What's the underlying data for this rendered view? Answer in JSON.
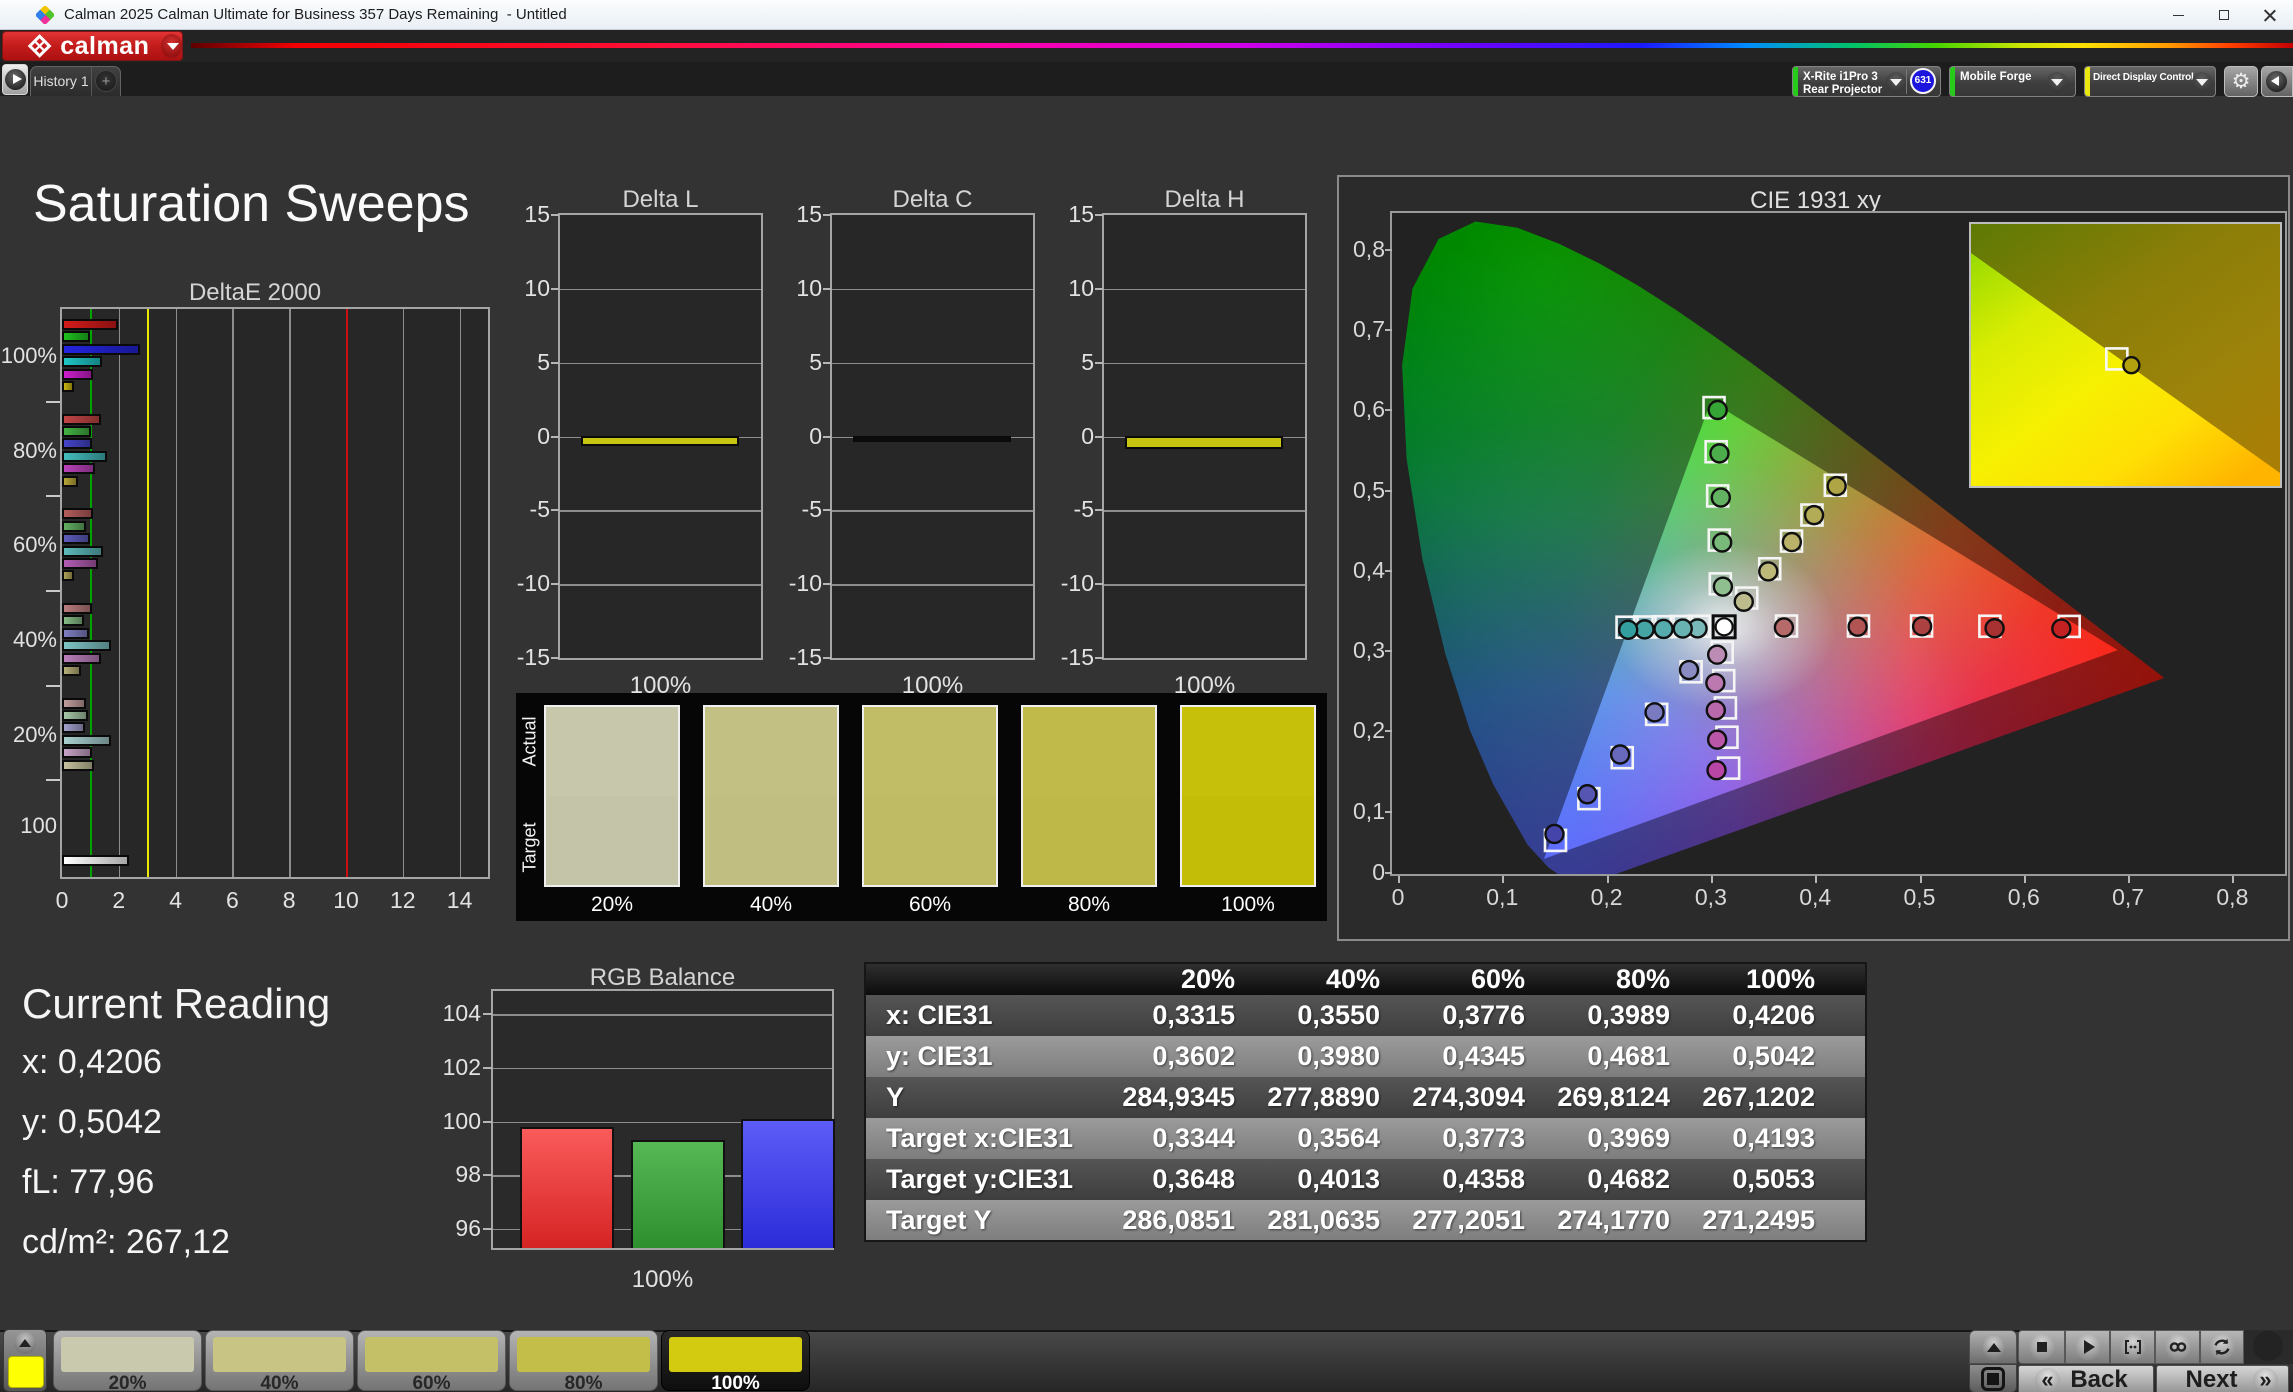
{
  "window": {
    "title": "Calman 2025 Calman Ultimate for Business 357 Days Remaining  - Untitled",
    "icon": "calman-app-icon",
    "controls": {
      "minimize": "minimize",
      "maximize": "maximize",
      "close": "close"
    }
  },
  "logo_bar": {
    "brand": "calman",
    "caret": "dropdown"
  },
  "tab_bar": {
    "play": "play",
    "tab": "History 1",
    "add_tab": "+",
    "meter_button": {
      "line1": "X-Rite i1Pro 3",
      "line2": "Rear Projector",
      "badge": "631",
      "stripe_color": "#27cc1a"
    },
    "source_button": {
      "label": "Mobile Forge",
      "stripe_color": "#27cc1a"
    },
    "ddc_button": {
      "label": "Direct Display Control",
      "stripe_color": "#e8e80e"
    },
    "gear": "settings",
    "back_arrow": "previous"
  },
  "page": {
    "title": "Saturation Sweeps"
  },
  "current_reading": {
    "title": "Current Reading",
    "lines": [
      "x: 0,4206",
      "y: 0,5042",
      "fL: 77,96",
      "cd/m²: 267,12"
    ]
  },
  "swatch_panel": {
    "row_labels": [
      "Actual",
      "Target"
    ],
    "items": [
      {
        "label": "20%",
        "actual": "#c7c7ab",
        "target": "#c4c4a8"
      },
      {
        "label": "40%",
        "actual": "#c3c083",
        "target": "#c1be81"
      },
      {
        "label": "60%",
        "actual": "#c0bd66",
        "target": "#bebb64"
      },
      {
        "label": "80%",
        "actual": "#bfba49",
        "target": "#bdb847"
      },
      {
        "label": "100%",
        "actual": "#c6c00a",
        "target": "#c3bd08"
      }
    ]
  },
  "bottom_bar": {
    "swatch_color": "#ffff04",
    "thumbs": [
      {
        "label": "20%",
        "color": "#c9c9ae",
        "selected": false
      },
      {
        "label": "40%",
        "color": "#c7c484",
        "selected": false
      },
      {
        "label": "60%",
        "color": "#c4c067",
        "selected": false
      },
      {
        "label": "80%",
        "color": "#c3be4a",
        "selected": false
      },
      {
        "label": "100%",
        "color": "#d2cb10",
        "selected": true
      }
    ],
    "back_label": "Back",
    "next_label": "Next",
    "transport": [
      "stop",
      "play",
      "loop-range",
      "infinite",
      "refresh"
    ]
  },
  "chart_data": [
    {
      "id": "deltae2000",
      "type": "bar",
      "orientation": "horizontal",
      "title": "DeltaE 2000",
      "xlim": [
        0,
        15
      ],
      "xticks": [
        0,
        2,
        4,
        6,
        8,
        10,
        12,
        14
      ],
      "ref_lines": [
        {
          "value": 1,
          "color": "#00a400"
        },
        {
          "value": 3,
          "color": "#e8e800"
        },
        {
          "value": 10,
          "color": "#cc1010"
        }
      ],
      "groups": [
        {
          "label": "100%",
          "values": [
            1.98,
            0.98,
            2.76,
            1.4,
            1.1,
            0.44
          ],
          "colors": [
            "#d31b1b",
            "#1fc01f",
            "#2424e0",
            "#1fc6c6",
            "#cc1fcc",
            "#c9b512"
          ]
        },
        {
          "label": "80%",
          "values": [
            1.38,
            1.02,
            1.06,
            1.6,
            1.15,
            0.56
          ],
          "colors": [
            "#c34545",
            "#43b243",
            "#4545cb",
            "#43bcbc",
            "#bc43bc",
            "#b7a738"
          ]
        },
        {
          "label": "60%",
          "values": [
            1.08,
            0.86,
            1.0,
            1.44,
            1.26,
            0.42
          ],
          "colors": [
            "#b55d5d",
            "#62ae62",
            "#5d5dbd",
            "#5dbaba",
            "#b25db2",
            "#aea157"
          ]
        },
        {
          "label": "40%",
          "values": [
            1.06,
            0.76,
            0.94,
            1.74,
            1.36,
            0.68
          ],
          "colors": [
            "#ba7c7c",
            "#85ba85",
            "#7f7fc2",
            "#7fc4c4",
            "#bc7fbc",
            "#b7af78"
          ]
        },
        {
          "label": "20%",
          "values": [
            0.86,
            0.9,
            0.8,
            1.72,
            1.04,
            1.13
          ],
          "colors": [
            "#c29e9e",
            "#a6c6a6",
            "#a0a0cc",
            "#a8cfcf",
            "#c6a3c6",
            "#c6c29e"
          ]
        },
        {
          "label": "100",
          "values": [
            2.35
          ],
          "colors": [
            "#ffffff"
          ]
        }
      ]
    },
    {
      "id": "delta_l",
      "type": "bar",
      "title": "Delta L",
      "ylim": [
        -15,
        15
      ],
      "yticks": [
        15,
        10,
        5,
        0,
        -5,
        -10,
        -15
      ],
      "categories": [
        "100%"
      ],
      "values": [
        -0.35
      ],
      "color": "#c8c412"
    },
    {
      "id": "delta_c",
      "type": "bar",
      "title": "Delta C",
      "ylim": [
        -15,
        15
      ],
      "yticks": [
        15,
        10,
        5,
        0,
        -5,
        -10,
        -15
      ],
      "categories": [
        "100%"
      ],
      "values": [
        -0.12
      ],
      "color": "#0c0c0c"
    },
    {
      "id": "delta_h",
      "type": "bar",
      "title": "Delta H",
      "ylim": [
        -15,
        15
      ],
      "yticks": [
        15,
        10,
        5,
        0,
        -5,
        -10,
        -15
      ],
      "categories": [
        "100%"
      ],
      "values": [
        -0.55
      ],
      "color": "#c8c412"
    },
    {
      "id": "cie1931",
      "type": "scatter",
      "title": "CIE 1931 xy",
      "xlim": [
        0,
        0.8
      ],
      "ylim": [
        0,
        0.8
      ],
      "xtick_labels": [
        "0",
        "0,1",
        "0,2",
        "0,3",
        "0,4",
        "0,5",
        "0,6",
        "0,7",
        "0,8"
      ],
      "ytick_labels": [
        "0",
        "0,1",
        "0,2",
        "0,3",
        "0,4",
        "0,5",
        "0,6",
        "0,7",
        "0,8"
      ],
      "white_point": {
        "x": 0.3127,
        "y": 0.329
      },
      "gamut_triangle": [
        [
          0.69,
          0.3
        ],
        [
          0.3,
          0.61
        ],
        [
          0.14,
          0.04
        ]
      ],
      "spectral_locus": [
        [
          0.1741,
          0.005
        ],
        [
          0.1714,
          0.0051
        ],
        [
          0.1644,
          0.0109
        ],
        [
          0.144,
          0.0297
        ],
        [
          0.1241,
          0.0578
        ],
        [
          0.0913,
          0.1327
        ],
        [
          0.0687,
          0.2007
        ],
        [
          0.0454,
          0.295
        ],
        [
          0.0235,
          0.4127
        ],
        [
          0.0082,
          0.5384
        ],
        [
          0.0039,
          0.6548
        ],
        [
          0.0139,
          0.7502
        ],
        [
          0.0389,
          0.812
        ],
        [
          0.0743,
          0.8338
        ],
        [
          0.1142,
          0.8262
        ],
        [
          0.1547,
          0.8059
        ],
        [
          0.1929,
          0.7816
        ],
        [
          0.2296,
          0.7543
        ],
        [
          0.2658,
          0.7243
        ],
        [
          0.3016,
          0.6923
        ],
        [
          0.3373,
          0.6589
        ],
        [
          0.3731,
          0.6245
        ],
        [
          0.4087,
          0.5896
        ],
        [
          0.4441,
          0.5547
        ],
        [
          0.4788,
          0.5202
        ],
        [
          0.5125,
          0.4866
        ],
        [
          0.5448,
          0.4544
        ],
        [
          0.5752,
          0.4242
        ],
        [
          0.6029,
          0.3965
        ],
        [
          0.627,
          0.3725
        ],
        [
          0.6482,
          0.3514
        ],
        [
          0.6658,
          0.334
        ],
        [
          0.6801,
          0.3197
        ],
        [
          0.6915,
          0.3083
        ],
        [
          0.7079,
          0.292
        ],
        [
          0.719,
          0.2809
        ],
        [
          0.726,
          0.274
        ],
        [
          0.7347,
          0.2653
        ]
      ],
      "series": [
        {
          "name": "red",
          "targets": [
            [
              0.3725,
              0.33
            ],
            [
              0.4415,
              0.33
            ],
            [
              0.502,
              0.33
            ],
            [
              0.5675,
              0.3297
            ],
            [
              0.6435,
              0.3295
            ]
          ],
          "measured": [
            [
              0.37,
              0.3282
            ],
            [
              0.4407,
              0.3291
            ],
            [
              0.5025,
              0.3296
            ],
            [
              0.572,
              0.3272
            ],
            [
              0.636,
              0.3268
            ]
          ],
          "colors": [
            "#b66a6a",
            "#b25454",
            "#ad4242",
            "#a83232",
            "#c42222"
          ]
        },
        {
          "name": "green",
          "targets": [
            [
              0.309,
              0.3825
            ],
            [
              0.308,
              0.437
            ],
            [
              0.3065,
              0.492
            ],
            [
              0.305,
              0.547
            ],
            [
              0.303,
              0.602
            ]
          ],
          "measured": [
            [
              0.3115,
              0.379
            ],
            [
              0.3108,
              0.434
            ],
            [
              0.3095,
              0.49
            ],
            [
              0.3082,
              0.545
            ],
            [
              0.3065,
              0.599
            ]
          ],
          "colors": [
            "#8fbf8f",
            "#79b979",
            "#62b262",
            "#4cac4c",
            "#35a535"
          ]
        },
        {
          "name": "blue",
          "targets": [
            [
              0.281,
              0.273
            ],
            [
              0.248,
              0.22
            ],
            [
              0.215,
              0.166
            ],
            [
              0.183,
              0.115
            ],
            [
              0.151,
              0.063
            ]
          ],
          "measured": [
            [
              0.279,
              0.2752
            ],
            [
              0.246,
              0.2225
            ],
            [
              0.213,
              0.17
            ],
            [
              0.1815,
              0.1205
            ],
            [
              0.15,
              0.071
            ]
          ],
          "colors": [
            "#8c8cc4",
            "#7a7ac0",
            "#6868bc",
            "#5656b2",
            "#4444aa"
          ]
        },
        {
          "name": "cyan",
          "targets": [
            [
              0.2887,
              0.3297
            ],
            [
              0.2715,
              0.3294
            ],
            [
              0.2541,
              0.3291
            ],
            [
              0.2368,
              0.3288
            ],
            [
              0.2196,
              0.3285
            ]
          ],
          "measured": [
            [
              0.2872,
              0.327
            ],
            [
              0.273,
              0.3268
            ],
            [
              0.2546,
              0.3263
            ],
            [
              0.2364,
              0.3258
            ],
            [
              0.2207,
              0.3253
            ]
          ],
          "colors": [
            "#79b9b9",
            "#68b2b2",
            "#56acac",
            "#45a5a5",
            "#339f9f"
          ]
        },
        {
          "name": "magenta",
          "targets": [
            [
              0.3108,
              0.2975
            ],
            [
              0.3123,
              0.262
            ],
            [
              0.3139,
              0.228
            ],
            [
              0.3154,
              0.1915
            ],
            [
              0.317,
              0.153
            ]
          ],
          "measured": [
            [
              0.306,
              0.2943
            ],
            [
              0.3043,
              0.259
            ],
            [
              0.3047,
              0.2251
            ],
            [
              0.306,
              0.1884
            ],
            [
              0.3054,
              0.1504
            ]
          ],
          "colors": [
            "#bc8cb4",
            "#bc79b0",
            "#b968ac",
            "#b956a8",
            "#b945a4"
          ]
        },
        {
          "name": "yellow",
          "targets": [
            [
              0.3344,
              0.3648
            ],
            [
              0.3564,
              0.4013
            ],
            [
              0.3773,
              0.4358
            ],
            [
              0.3969,
              0.4682
            ],
            [
              0.4193,
              0.5053
            ]
          ],
          "measured": [
            [
              0.3315,
              0.3602
            ],
            [
              0.355,
              0.398
            ],
            [
              0.3776,
              0.4345
            ],
            [
              0.3989,
              0.4681
            ],
            [
              0.4206,
              0.5042
            ]
          ],
          "colors": [
            "#bcbc8c",
            "#bcb979",
            "#b9b268",
            "#b2ac56",
            "#afa545"
          ]
        }
      ],
      "inset": {
        "square": [
          0.472,
          0.515
        ],
        "circle": [
          0.519,
          0.539
        ]
      }
    },
    {
      "id": "rgb_balance",
      "type": "bar",
      "title": "RGB Balance",
      "categories": [
        "100%"
      ],
      "series": [
        {
          "name": "Red",
          "value": 99.8,
          "color_top": "#fa5b5b",
          "color_bottom": "#d62424"
        },
        {
          "name": "Green",
          "value": 99.3,
          "color_top": "#55b855",
          "color_bottom": "#2e8f2e"
        },
        {
          "name": "Blue",
          "value": 100.1,
          "color_top": "#5c5cf8",
          "color_bottom": "#2c2cd8"
        }
      ],
      "ylim": [
        95.28,
        104.87
      ],
      "yticks": [
        96,
        98,
        100,
        102,
        104
      ]
    },
    {
      "id": "readings_table",
      "type": "table",
      "columns": [
        "20%",
        "40%",
        "60%",
        "80%",
        "100%"
      ],
      "rows": [
        {
          "label": "x: CIE31",
          "values": [
            "0,3315",
            "0,3550",
            "0,3776",
            "0,3989",
            "0,4206"
          ]
        },
        {
          "label": "y: CIE31",
          "values": [
            "0,3602",
            "0,3980",
            "0,4345",
            "0,4681",
            "0,5042"
          ]
        },
        {
          "label": "Y",
          "values": [
            "284,9345",
            "277,8890",
            "274,3094",
            "269,8124",
            "267,1202"
          ]
        },
        {
          "label": "Target x:CIE31",
          "values": [
            "0,3344",
            "0,3564",
            "0,3773",
            "0,3969",
            "0,4193"
          ]
        },
        {
          "label": "Target y:CIE31",
          "values": [
            "0,3648",
            "0,4013",
            "0,4358",
            "0,4682",
            "0,5053"
          ]
        },
        {
          "label": "Target Y",
          "values": [
            "286,0851",
            "281,0635",
            "277,2051",
            "274,1770",
            "271,2495"
          ]
        }
      ]
    }
  ]
}
